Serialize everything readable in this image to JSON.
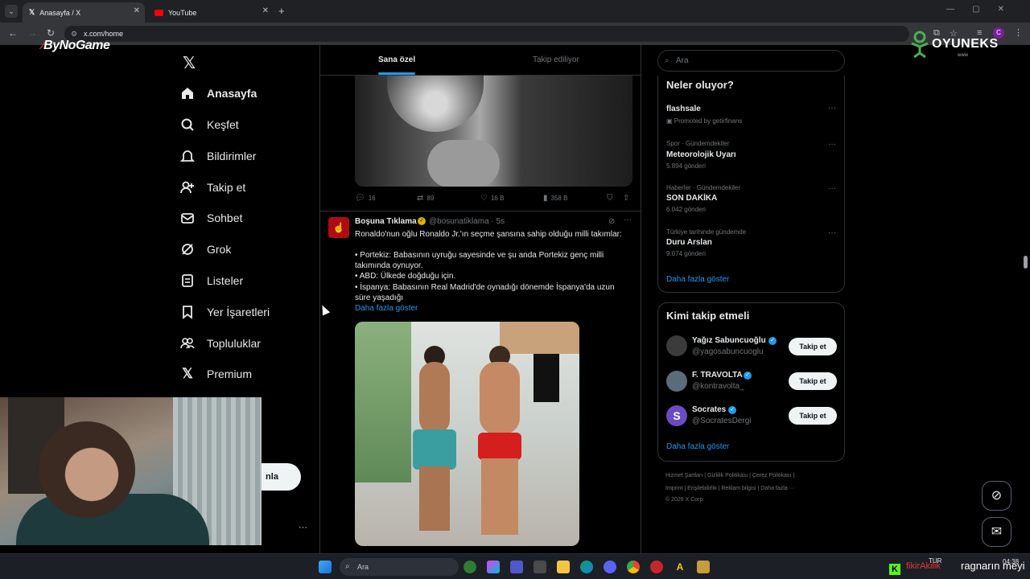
{
  "browser": {
    "tabs": [
      {
        "title": "Anasayfa / X",
        "active": true,
        "icon": "x-icon"
      },
      {
        "title": "YouTube",
        "active": false,
        "icon": "youtube-icon"
      }
    ],
    "url": "x.com/home",
    "profile_initial": "C"
  },
  "overlays": {
    "bynogame": "ByNoGame",
    "oyuneks": "OYUNEKS",
    "oyuneks_sub": "www",
    "kick_prefix": "fikirAkilik",
    "kick_name": "ragnarın meyi"
  },
  "sidebar": {
    "items": [
      {
        "label": "Anasayfa",
        "icon": "home-icon",
        "active": true
      },
      {
        "label": "Keşfet",
        "icon": "search-icon"
      },
      {
        "label": "Bildirimler",
        "icon": "bell-icon"
      },
      {
        "label": "Takip et",
        "icon": "follow-icon"
      },
      {
        "label": "Sohbet",
        "icon": "mail-icon"
      },
      {
        "label": "Grok",
        "icon": "grok-icon"
      },
      {
        "label": "Listeler",
        "icon": "list-icon"
      },
      {
        "label": "Yer İşaretleri",
        "icon": "bookmark-icon"
      },
      {
        "label": "Topluluklar",
        "icon": "people-icon"
      },
      {
        "label": "Premium",
        "icon": "x-icon"
      }
    ],
    "post_button_partial": "nla"
  },
  "feed": {
    "tabs": [
      "Sana özel",
      "Takip ediliyor"
    ],
    "post1_actions": {
      "replies": "16",
      "retweets": "89",
      "likes": "16 B",
      "views": "358 B"
    },
    "post2": {
      "name": "Boşuna Tıklama",
      "handle": "@bosunatiklama · 5s",
      "lines": [
        "Ronaldo'nun oğlu Ronaldo Jr.'ın seçme şansına sahip olduğu milli takımlar:",
        "",
        "• Portekiz: Babasının uyruğu sayesinde ve şu anda Portekiz genç milli",
        "takımında oynuyor.",
        "• ABD: Ülkede doğduğu için.",
        "• İspanya: Babasının Real Madrid'de oynadığı dönemde İspanya'da uzun",
        "süre yaşadığı"
      ],
      "show_more": "Daha fazla göster"
    }
  },
  "right": {
    "search_placeholder": "Ara",
    "trends_title": "Neler oluyor?",
    "trends": [
      {
        "meta": "",
        "name": "flashsale",
        "count": "Promoted by getirfinans"
      },
      {
        "meta": "Spor · Gündemdekiler",
        "name": "Meteorolojik Uyarı",
        "count": "5.894 gönderi"
      },
      {
        "meta": "Haberler · Gündemdekiler",
        "name": "SON DAKİKA",
        "count": "6.042 gönderi"
      },
      {
        "meta": "Türkiye tarihinde gündemde",
        "name": "Duru Arslan",
        "count": "9.074 gönderi"
      }
    ],
    "trends_more": "Daha fazla göster",
    "follow_title": "Kimi takip etmeli",
    "follow": [
      {
        "name": "Yağız Sabuncuoğlu",
        "handle": "@yagosabuncuoglu",
        "btn": "Takip et"
      },
      {
        "name": "F. TRAVOLTA",
        "handle": "@kontravolta_",
        "btn": "Takip et"
      },
      {
        "name": "Socrates",
        "handle": "@SocratesDergi",
        "btn": "Takip et"
      }
    ],
    "follow_more": "Daha fazla göster",
    "footer_line1": "Hizmet Şartları  |  Gizlilik Politikası  |  Çerez Politikası  |",
    "footer_line2": "Imprint  |  Erişilebilirlik  |  Reklam bilgisi  |  Daha fazla ···",
    "footer_line3": "© 2026 X Corp."
  },
  "taskbar": {
    "search": "Ara",
    "time": "04:38",
    "lang": "TUR"
  }
}
